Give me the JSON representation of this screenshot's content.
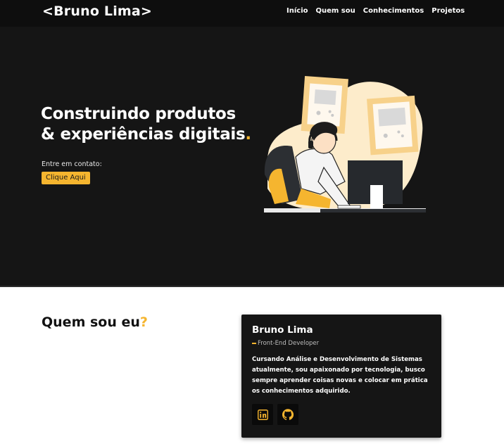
{
  "navbar": {
    "logo": "<Bruno Lima>",
    "links": [
      "Início",
      "Quem sou",
      "Conhecimentos",
      "Projetos"
    ]
  },
  "hero": {
    "title_line1": "Construindo produtos",
    "title_line2": "& experiências digitais",
    "title_dot": ".",
    "contact_label": "Entre em contato:",
    "cta_label": "Clique Aqui",
    "illustration_icon": "developer-at-desk-illustration"
  },
  "about": {
    "title": "Quem sou eu",
    "title_mark": "?",
    "card": {
      "name": "Bruno Lima",
      "role": "Front-End Developer",
      "bio": "Cursando Análise e Desenvolvimento de Sistemas atualmente, sou apaixonado por tecnologia, busco sempre aprender coisas novas e colocar em prática os conhecimentos adquirido.",
      "social_icons": [
        "linkedin-icon",
        "github-icon"
      ]
    }
  },
  "colors": {
    "accent": "#f5b52f",
    "dark": "#151515",
    "navbar": "#0e0e0e"
  }
}
